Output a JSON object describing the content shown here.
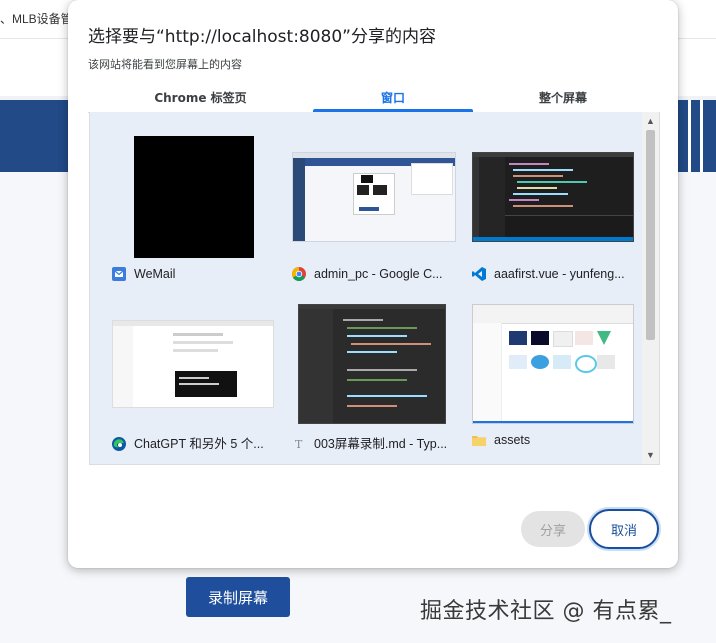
{
  "background": {
    "tab_label": "、MLB设备管",
    "record_button": "录制屏幕",
    "watermark": "掘金技术社区 @ 有点累_"
  },
  "dialog": {
    "title": "选择要与“http://localhost:8080”分享的内容",
    "subtitle": "该网站将能看到您屏幕上的内容",
    "tabs": [
      "Chrome 标签页",
      "窗口",
      "整个屏幕"
    ],
    "active_tab": "窗口",
    "items": [
      {
        "label": "WeMail",
        "icon": "mail-app-icon"
      },
      {
        "label": "admin_pc - Google C...",
        "icon": "chrome-icon"
      },
      {
        "label": "aaafirst.vue - yunfeng...",
        "icon": "vscode-icon"
      },
      {
        "label": "ChatGPT 和另外 5 个...",
        "icon": "edge-icon"
      },
      {
        "label": "003屏幕录制.md - Typ...",
        "icon": "typora-icon"
      },
      {
        "label": "assets",
        "icon": "folder-icon"
      }
    ],
    "share_button": "分享",
    "cancel_button": "取消"
  },
  "colors": {
    "accent": "#1a73e8",
    "brand_dark_blue": "#1f4e9c",
    "grid_background": "#e8eef7"
  }
}
